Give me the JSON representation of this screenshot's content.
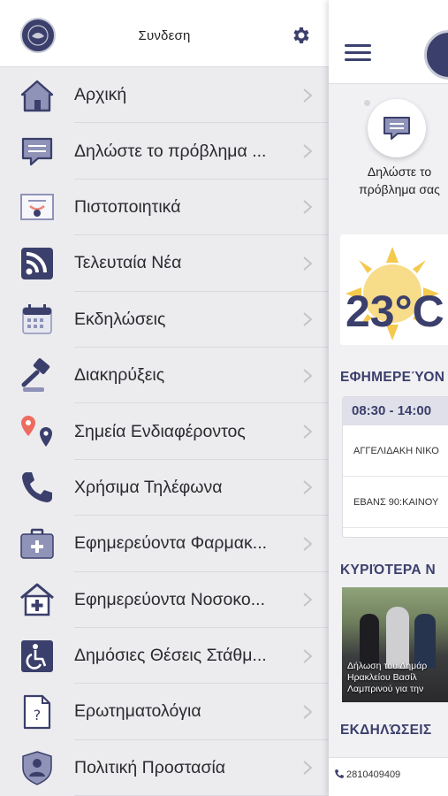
{
  "drawer": {
    "login_label": "Συνδεση",
    "items": [
      {
        "label": "Αρχική",
        "icon": "home-icon"
      },
      {
        "label": "Δηλώστε το πρόβλημα ...",
        "icon": "chat-bubble-icon"
      },
      {
        "label": "Πιστοποιητικά",
        "icon": "certificate-icon"
      },
      {
        "label": "Τελευταία Νέα",
        "icon": "rss-icon"
      },
      {
        "label": "Εκδηλώσεις",
        "icon": "calendar-icon"
      },
      {
        "label": "Διακηρύξεις",
        "icon": "gavel-icon"
      },
      {
        "label": "Σημεία Ενδιαφέροντος",
        "icon": "map-pins-icon"
      },
      {
        "label": "Χρήσιμα Τηλέφωνα",
        "icon": "phone-icon"
      },
      {
        "label": "Εφημερεύοντα Φαρμακ...",
        "icon": "medical-kit-icon"
      },
      {
        "label": "Εφημερεύοντα Νοσοκο...",
        "icon": "hospital-icon"
      },
      {
        "label": "Δημόσιες Θέσεις Στάθμ...",
        "icon": "wheelchair-icon"
      },
      {
        "label": "Ερωτηματολόγια",
        "icon": "questionnaire-icon"
      },
      {
        "label": "Πολιτική Προστασία",
        "icon": "civil-protection-icon"
      }
    ]
  },
  "main": {
    "report_label": "Δηλώστε το πρόβλημα σας",
    "weather_temp": "23°C",
    "pharmacies_title": "ΕΦΗΜΕΡΕΎΟΝ",
    "pharmacy_time": "08:30 - 14:00",
    "pharmacy_rows": [
      "ΑΓΓΕΛΙΔΑΚΗ ΝΙΚΟ",
      "ΕΒΑΝΣ 90:ΚΑΙΝΟΥ"
    ],
    "news_title": "ΚΥΡΙΌΤΕΡΑ Ν",
    "news_caption_lines": [
      "Δήλωση του Δημάρ",
      "Ηρακλείου Βασίλ",
      "Λαμπρινού για την"
    ],
    "events_title": "ΕΚΔΗΛΏΣΕΙΣ",
    "phone": "2810409409"
  },
  "colors": {
    "accent": "#3b3f6b",
    "drawer_bg": "#ececef",
    "icon_light": "#8f93b8"
  }
}
